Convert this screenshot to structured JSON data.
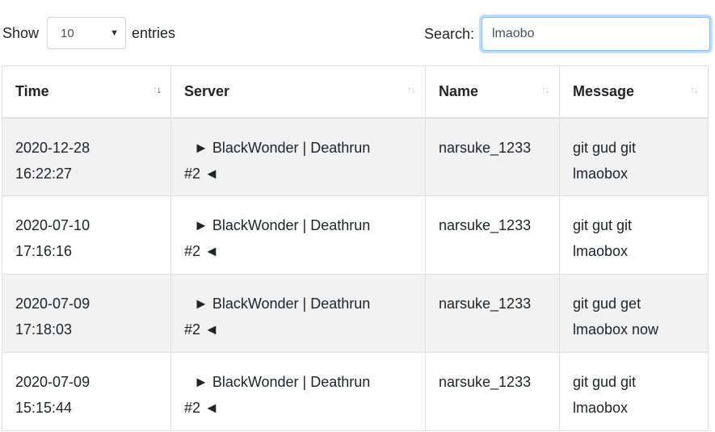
{
  "length": {
    "prefix": "Show",
    "selected": "10",
    "suffix": "entries"
  },
  "search": {
    "label": "Search:",
    "value": "lmaobo"
  },
  "table": {
    "headers": [
      "Time",
      "Server",
      "Name",
      "Message"
    ],
    "rows": [
      {
        "time_date": "2020-12-28",
        "time_clock": "16:22:27",
        "server_line1": "► BlackWonder | Deathrun",
        "server_line2": "#2 ◄",
        "name": "narsuke_1233",
        "msg_line1": "git gud git",
        "msg_line2": "lmaobox"
      },
      {
        "time_date": "2020-07-10",
        "time_clock": "17:16:16",
        "server_line1": "► BlackWonder | Deathrun",
        "server_line2": "#2 ◄",
        "name": "narsuke_1233",
        "msg_line1": "git gut git",
        "msg_line2": "lmaobox"
      },
      {
        "time_date": "2020-07-09",
        "time_clock": "17:18:03",
        "server_line1": "► BlackWonder | Deathrun",
        "server_line2": "#2 ◄",
        "name": "narsuke_1233",
        "msg_line1": "git gud get",
        "msg_line2": "lmaobox now"
      },
      {
        "time_date": "2020-07-09",
        "time_clock": "15:15:44",
        "server_line1": "► BlackWonder | Deathrun",
        "server_line2": "#2 ◄",
        "name": "narsuke_1233",
        "msg_line1": "git gud git",
        "msg_line2": "lmaobox"
      }
    ]
  }
}
